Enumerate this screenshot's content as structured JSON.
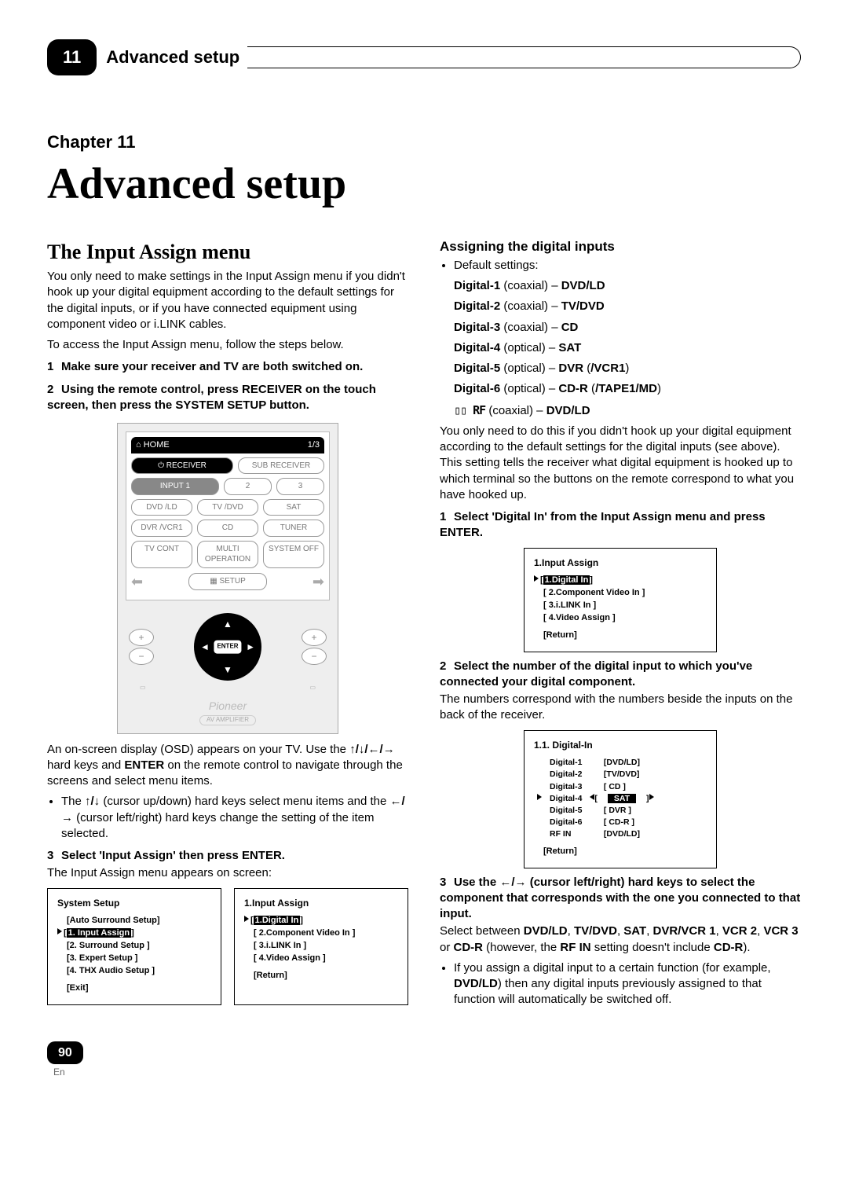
{
  "header": {
    "tab_number": "11",
    "tab_title": "Advanced setup"
  },
  "chapter": {
    "label": "Chapter 11",
    "title": "Advanced setup"
  },
  "left": {
    "h2": "The Input Assign menu",
    "p1": "You only need to make settings in the Input Assign menu if you didn't hook up your digital equipment according to the default settings for the digital inputs, or if you have connected equipment using component video or i.LINK cables.",
    "p2": "To access the Input Assign menu, follow the steps below.",
    "step1": "Make sure your receiver and TV are both switched on.",
    "step2": "Using the remote control, press RECEIVER on the touch screen, then press the SYSTEM SETUP button.",
    "osd_intro1": "An on-screen display (OSD) appears on your TV. Use the ",
    "osd_keys": "↑/↓/←/→",
    "osd_intro2": " hard keys and ",
    "osd_enter": "ENTER",
    "osd_intro3": " on the remote control to navigate through the screens and select menu items.",
    "bul_a": "The ",
    "bul_ud": "↑/↓",
    "bul_b": " (cursor up/down) hard keys select menu items and the ",
    "bul_lr": "←/→",
    "bul_c": " (cursor left/right) hard keys change the setting of the item selected.",
    "step3": "Select 'Input Assign' then press ENTER.",
    "step3_body": "The Input Assign menu appears on screen:"
  },
  "remote": {
    "home": "HOME",
    "frac": "1/3",
    "receiver": "RECEIVER",
    "sub_receiver": "SUB RECEIVER",
    "input1": "INPUT 1",
    "t2": "2",
    "t3": "3",
    "dvdld": "DVD /LD",
    "tvdvd": "TV /DVD",
    "sat": "SAT",
    "dvrvcr1": "DVR /VCR1",
    "cd": "CD",
    "tuner": "TUNER",
    "tvcont": "TV CONT",
    "multi": "MULTI OPERATION",
    "sysoff": "SYSTEM OFF",
    "setup": "SETUP",
    "enter": "ENTER",
    "brand": "Pioneer",
    "subbrand": "AV AMPLIFIER"
  },
  "osd1": {
    "title": "System Setup",
    "auto": "[Auto Surround Setup]",
    "i1": "1. Input Assign",
    "i2": "[2. Surround Setup ]",
    "i3": "[3. Expert Setup ]",
    "i4": "[4. THX Audio Setup ]",
    "exit": "[Exit]"
  },
  "osd2": {
    "title": "1.Input Assign",
    "i1": "1.Digital In",
    "i2": "[ 2.Component Video In ]",
    "i3": "[ 3.i.LINK In ]",
    "i4": "[ 4.Video Assign ]",
    "ret": "[Return]"
  },
  "right": {
    "h3": "Assigning the digital inputs",
    "def_label": "Default settings:",
    "d1a": "Digital-1",
    "d1b": " (coaxial) – ",
    "d1c": "DVD/LD",
    "d2a": "Digital-2",
    "d2b": " (coaxial) – ",
    "d2c": "TV/DVD",
    "d3a": "Digital-3",
    "d3b": " (coaxial) – ",
    "d3c": "CD",
    "d4a": "Digital-4",
    "d4b": " (optical) – ",
    "d4c": "SAT",
    "d5a": "Digital-5",
    "d5b": " (optical) – ",
    "d5c": "DVR",
    "d5d": " (",
    "d5e": "/VCR1",
    "d5f": ")",
    "d6a": "Digital-6",
    "d6b": " (optical) – ",
    "d6c": "CD-R",
    "d6d": " (",
    "d6e": "/TAPE1/MD",
    "d6f": ")",
    "rfa": "▯▯ RF",
    "rfb": " (coaxial) – ",
    "rfc": "DVD/LD",
    "p_after": "You only need to do this if you didn't hook up your digital equipment according to the default settings for the digital inputs (see above). This setting tells the receiver what digital equipment is hooked up to which terminal so the buttons on the remote correspond to what you have hooked up.",
    "step1": "Select 'Digital In' from the Input Assign menu and press ENTER.",
    "step2": "Select the number of the digital input to which you've connected your digital component.",
    "step2_body": "The numbers correspond with the numbers beside the inputs on the back of the receiver.",
    "step3a": "Use the ",
    "step3arr": "←/→",
    "step3b": " (cursor left/right) hard keys to select the component that corresponds with the one you connected to that input.",
    "step3_body_a": "Select between ",
    "step3_body_b": "DVD/LD",
    "step3_body_c": ", ",
    "step3_body_d": "TV/DVD",
    "step3_body_e": ", ",
    "step3_body_f": "SAT",
    "step3_body_g": ", ",
    "step3_body_h": "DVR/VCR 1",
    "step3_body_i": ", ",
    "step3_body_j": "VCR 2",
    "step3_body_k": ", ",
    "step3_body_l": "VCR 3",
    "step3_body_m": " or ",
    "step3_body_n": "CD-R",
    "step3_body_o": " (however, the ",
    "step3_body_p": "RF IN",
    "step3_body_q": " setting doesn't include ",
    "step3_body_r": "CD-R",
    "step3_body_s": ").",
    "bul2a": "If you assign a digital input to a certain function (for example, ",
    "bul2b": "DVD/LD",
    "bul2c": ") then any digital inputs previously assigned to that function will automatically be switched off."
  },
  "osd3": {
    "title": "1.Input Assign",
    "i1": "1.Digital In",
    "i2": "[ 2.Component Video In ]",
    "i3": "[ 3.i.LINK In ]",
    "i4": "[ 4.Video Assign ]",
    "ret": "[Return]"
  },
  "osd4": {
    "title": "1.1. Digital-In",
    "r1a": "Digital-1",
    "r1b": "[DVD/LD]",
    "r2a": "Digital-2",
    "r2b": "[TV/DVD]",
    "r3a": "Digital-3",
    "r3b": "[   CD   ]",
    "r4a": "Digital-4",
    "r4b": "SAT",
    "r5a": "Digital-5",
    "r5b": "[  DVR  ]",
    "r6a": "Digital-6",
    "r6b": "[  CD-R  ]",
    "r7a": "RF  IN",
    "r7b": "[DVD/LD]",
    "ret": "[Return]"
  },
  "footer": {
    "page": "90",
    "lang": "En"
  }
}
